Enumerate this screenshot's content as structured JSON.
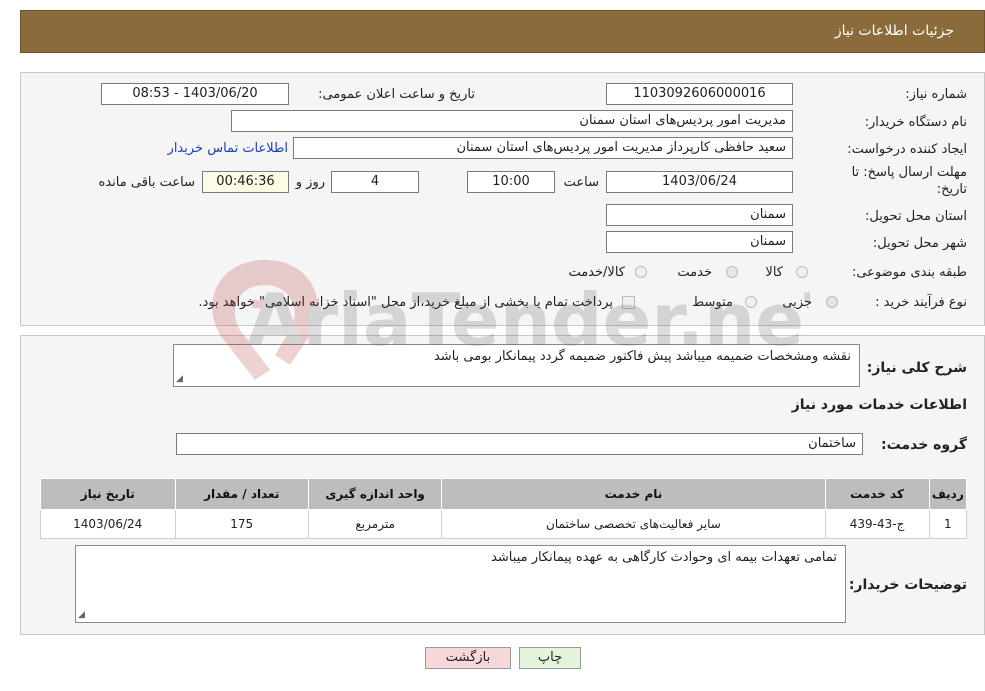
{
  "header": {
    "title": "جزئیات اطلاعات نیاز"
  },
  "form": {
    "need_number_label": "شماره نیاز:",
    "need_number": "1103092606000016",
    "announce_label": "تاریخ و ساعت اعلان عمومی:",
    "announce_value": "1403/06/20 - 08:53",
    "buyer_org_label": "نام دستگاه خریدار:",
    "buyer_org": "مدیریت امور پردیس‌های استان سمنان",
    "creator_label": "ایجاد کننده درخواست:",
    "creator": "سعید حافظی کارپرداز مدیریت امور پردیس‌های استان سمنان",
    "contact_link": "اطلاعات تماس خریدار",
    "deadline_label_line1": "مهلت ارسال پاسخ: تا",
    "deadline_label_line2": "تاریخ:",
    "deadline_date": "1403/06/24",
    "time_label": "ساعت",
    "deadline_time": "10:00",
    "days_value": "4",
    "days_label": "روز و",
    "remaining_time": "00:46:36",
    "remaining_label": "ساعت باقی مانده",
    "province_label": "استان محل تحویل:",
    "province": "سمنان",
    "city_label": "شهر محل تحویل:",
    "city": "سمنان",
    "category_label": "طبقه بندی موضوعی:",
    "category_options": [
      "کالا",
      "خدمت",
      "کالا/خدمت"
    ],
    "process_label": "نوع فرآیند خرید :",
    "process_options": [
      "جزیی",
      "متوسط"
    ],
    "payment_note": "پرداخت تمام یا بخشی از مبلغ خرید،از محل \"اسناد خزانه اسلامی\" خواهد بود."
  },
  "details": {
    "description_label": "شرح کلی نیاز:",
    "description": "نقشه ومشخصات ضمیمه میباشد پیش فاکتور ضمیمه گردد پیمانکار بومی باشد",
    "services_title": "اطلاعات خدمات مورد نیاز",
    "service_group_label": "گروه خدمت:",
    "service_group": "ساختمان",
    "table": {
      "headers": [
        "ردیف",
        "کد خدمت",
        "نام خدمت",
        "واحد اندازه گیری",
        "تعداد / مقدار",
        "تاریخ نیاز"
      ],
      "rows": [
        [
          "1",
          "ج-43-439",
          "سایر فعالیت‌های تخصصی ساختمان",
          "مترمربع",
          "175",
          "1403/06/24"
        ]
      ]
    },
    "buyer_notes_label": "توضیحات خریدار:",
    "buyer_notes": "تمامی تعهدات بیمه ای وحوادث کارگاهی به عهده پیمانکار میباشد"
  },
  "buttons": {
    "print": "چاپ",
    "back": "بازگشت"
  },
  "watermark": {
    "text": "AriaTender.neT"
  },
  "colors": {
    "header_bg": "#8b6b3c",
    "link": "#1a3fbf",
    "back_btn": "#f7d7d7",
    "print_btn": "#e4f4dc"
  }
}
